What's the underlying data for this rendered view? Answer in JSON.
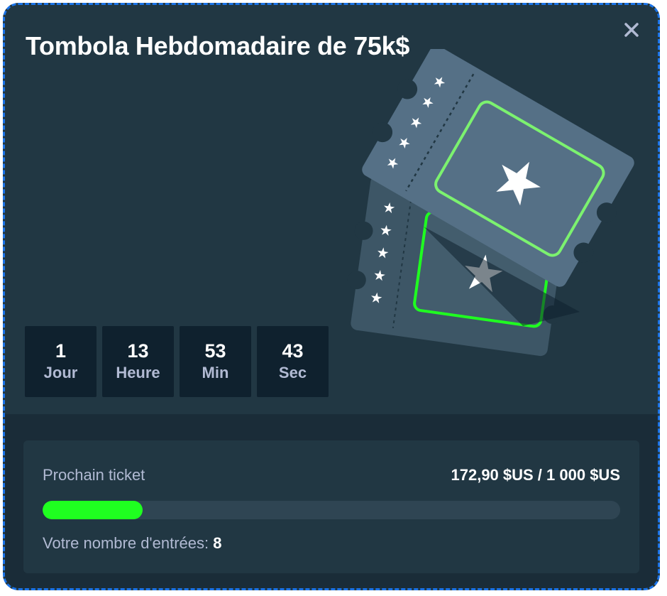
{
  "modal": {
    "title": "Tombola Hebdomadaire de 75k$",
    "close_icon": "close-icon"
  },
  "countdown": [
    {
      "value": "1",
      "label": "Jour"
    },
    {
      "value": "13",
      "label": "Heure"
    },
    {
      "value": "53",
      "label": "Min"
    },
    {
      "value": "43",
      "label": "Sec"
    }
  ],
  "progress": {
    "label": "Prochain ticket",
    "amount": "172,90 $US / 1 000 $US",
    "fraction": 0.1729,
    "color": "#1fff20"
  },
  "entries": {
    "label": "Votre nombre d'entrées:",
    "count": "8"
  },
  "illustration": "raffle-tickets-icon",
  "colors": {
    "background": "#213743",
    "panel": "#1a2c38",
    "timer_box": "#0f212e",
    "accent_green": "#1fff20",
    "focus_border": "#1a73e8"
  }
}
